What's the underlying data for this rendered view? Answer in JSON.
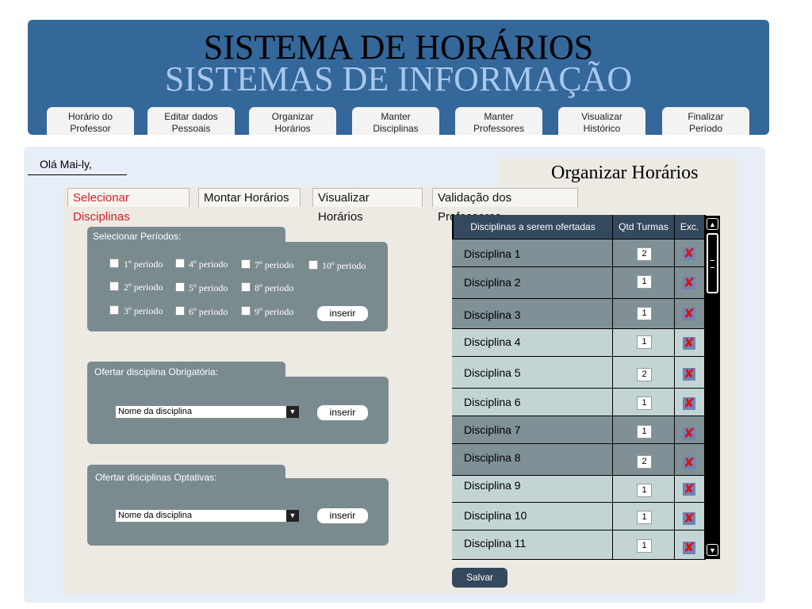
{
  "header": {
    "title": "SISTEMA DE HORÁRIOS",
    "subtitle": "SISTEMAS DE INFORMAÇÃO",
    "nav": [
      {
        "line1": "Horário do",
        "line2": "Professor"
      },
      {
        "line1": "Editar dados",
        "line2": "Pessoais"
      },
      {
        "line1": "Organizar",
        "line2": "Horários"
      },
      {
        "line1": "Manter",
        "line2": "Disciplinas"
      },
      {
        "line1": "Manter",
        "line2": "Professores"
      },
      {
        "line1": "Visualizar",
        "line2": "Histórico"
      },
      {
        "line1": "Finalizar",
        "line2": "Período"
      }
    ]
  },
  "greeting": "Olá Mai-ly,",
  "page_title": "Organizar Horários",
  "tabs": [
    "Selecionar Disciplinas",
    "Montar Horários",
    "Visualizar Horários",
    "Validação dos Professores"
  ],
  "periods": {
    "label": "Selecionar Períodos:",
    "items": [
      "1º periodo",
      "2º periodo",
      "3º periodo",
      "4º periodo",
      "5º periodo",
      "6º periodo",
      "7º periodo",
      "8º periodo",
      "9º periodo",
      "10º periodo"
    ],
    "insert_label": "inserir"
  },
  "mandatory": {
    "label": "Ofertar disciplina Obrigatória:",
    "select_value": "Nome da disciplina",
    "insert_label": "inserir"
  },
  "optional": {
    "label": "Ofertar disciplinas Optativas:",
    "select_value": "Nome da disciplina",
    "insert_label": "inserir"
  },
  "table": {
    "headers": [
      "Disciplinas a serem ofertadas",
      "Qtd Turmas",
      "Exc."
    ],
    "rows": [
      {
        "name": "Disciplina 1",
        "qty": "2"
      },
      {
        "name": "Disciplina 2",
        "qty": "1"
      },
      {
        "name": "Disciplina 3",
        "qty": "1"
      },
      {
        "name": "Disciplina 4",
        "qty": "1"
      },
      {
        "name": "Disciplina 5",
        "qty": "2"
      },
      {
        "name": "Disciplina 6",
        "qty": "1"
      },
      {
        "name": "Disciplina 7",
        "qty": "1"
      },
      {
        "name": "Disciplina 8",
        "qty": "2"
      },
      {
        "name": "Disciplina 9",
        "qty": "1"
      },
      {
        "name": "Disciplina 10",
        "qty": "1"
      },
      {
        "name": "Disciplina 11",
        "qty": "1"
      }
    ]
  },
  "save_label": "Salvar",
  "colors": {
    "header_bg": "#34679a",
    "subtitle": "#a9c8ee",
    "panel": "#7a8b90",
    "table_header": "#34495e",
    "row_dark": "#7f9196",
    "row_light": "#c2d5d4",
    "active_tab": "#d0202a"
  },
  "icons": {
    "delete": "delete-x-icon",
    "dropdown": "chevron-down-icon",
    "scroll_up": "scroll-up-icon",
    "scroll_down": "scroll-down-icon"
  }
}
